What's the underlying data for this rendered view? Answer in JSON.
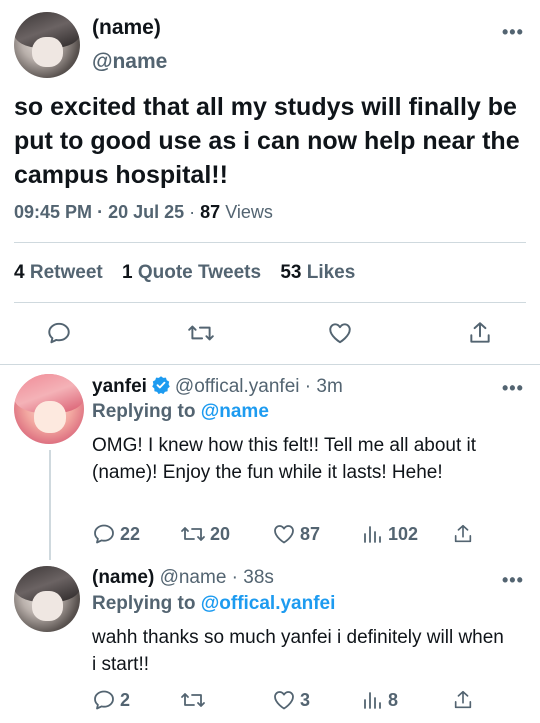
{
  "main_tweet": {
    "display_name": "(name)",
    "handle": "@name",
    "text": "so excited that all my studys will finally be put to good use as i can now help near the campus hospital!!",
    "time": "09:45 PM",
    "date": "20 Jul 25",
    "views_count": "87",
    "views_label": "Views",
    "retweets_count": "4",
    "retweets_label": "Retweet",
    "quotes_count": "1",
    "quotes_label": "Quote Tweets",
    "likes_count": "53",
    "likes_label": "Likes",
    "more_label": "•••"
  },
  "replies": [
    {
      "display_name": "yanfei",
      "verified": true,
      "handle": "@offical.yanfei",
      "time": "3m",
      "replying_to_label": "Replying to",
      "replying_to_handle": "@name",
      "text": "OMG! I knew how this felt!! Tell me all about it (name)! Enjoy the fun while it lasts! Hehe!",
      "reply_count": "22",
      "retweet_count": "20",
      "like_count": "87",
      "view_count": "102",
      "more_label": "•••"
    },
    {
      "display_name": "(name)",
      "handle": "@name",
      "time": "38s",
      "replying_to_label": "Replying to",
      "replying_to_handle": "@offical.yanfei",
      "text": "wahh thanks so much yanfei i definitely will when i start!!",
      "reply_count": "2",
      "retweet_count": "",
      "like_count": "3",
      "view_count": "8",
      "more_label": "•••"
    }
  ],
  "colors": {
    "link": "#1d9bf0",
    "secondary_text": "#536471",
    "primary_text": "#0f1419",
    "divider": "#cfd9de"
  }
}
